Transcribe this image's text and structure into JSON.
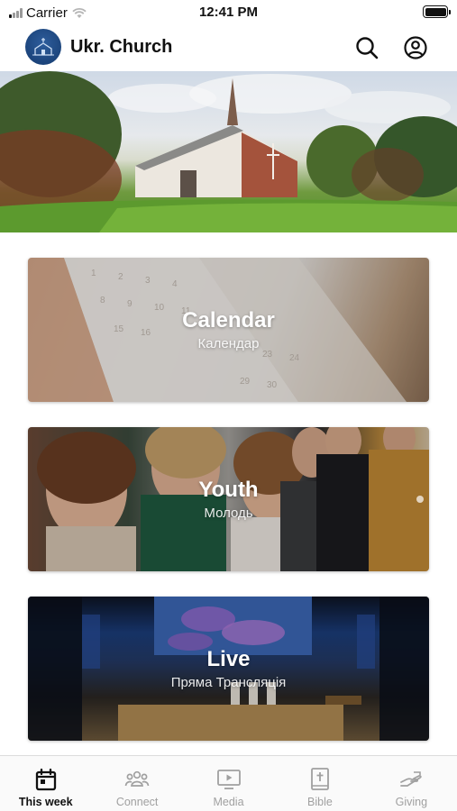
{
  "status_bar": {
    "carrier": "Carrier",
    "time": "12:41 PM"
  },
  "header": {
    "title": "Ukr. Church",
    "logo_icon": "church-logo-icon",
    "search_icon": "search-icon",
    "profile_icon": "profile-icon"
  },
  "hero": {
    "image": "church-building-photo"
  },
  "cards": [
    {
      "title": "Calendar",
      "subtitle": "Календар",
      "image": "calendar-photo"
    },
    {
      "title": "Youth",
      "subtitle": "Молодь",
      "image": "youth-group-photo"
    },
    {
      "title": "Live",
      "subtitle": "Пряма Трансляція",
      "image": "live-service-photo"
    }
  ],
  "tabs": [
    {
      "label": "This week",
      "icon": "calendar-icon",
      "active": true
    },
    {
      "label": "Connect",
      "icon": "group-icon",
      "active": false
    },
    {
      "label": "Media",
      "icon": "play-screen-icon",
      "active": false
    },
    {
      "label": "Bible",
      "icon": "bible-icon",
      "active": false
    },
    {
      "label": "Giving",
      "icon": "giving-hand-icon",
      "active": false
    }
  ],
  "colors": {
    "accent": "#111111",
    "inactive_tab": "#a0a0a0",
    "logo_blue": "#1f4a85"
  }
}
